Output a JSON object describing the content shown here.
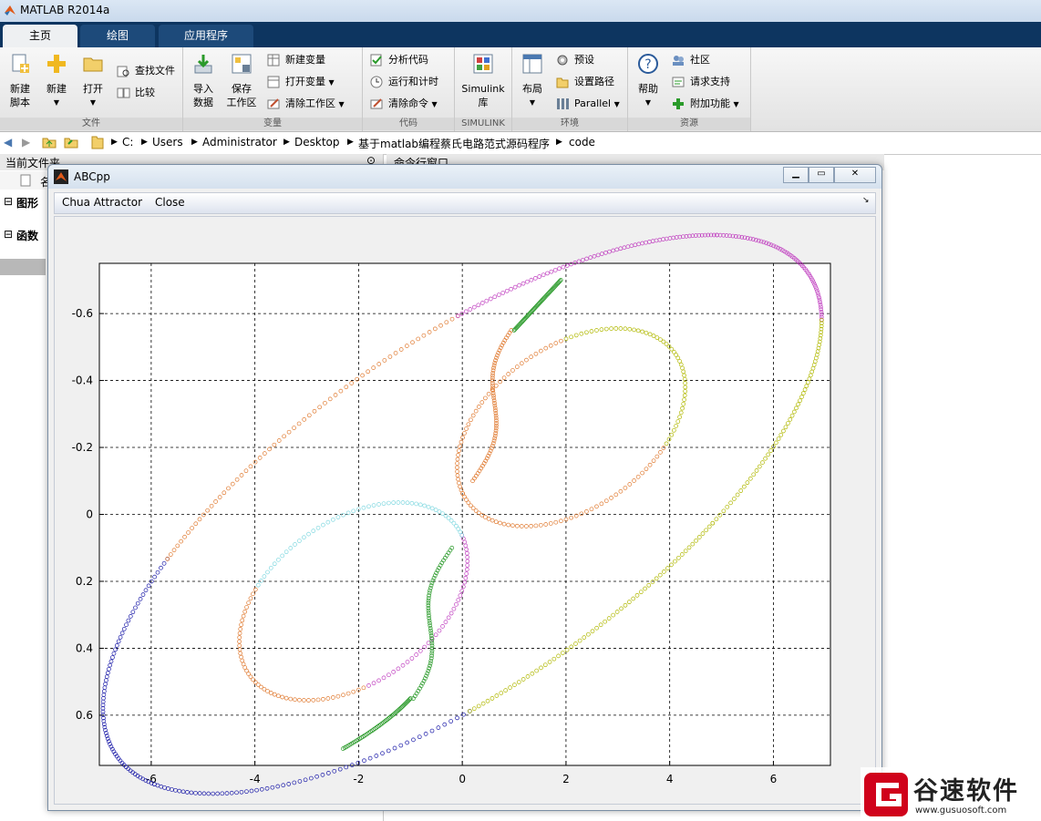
{
  "app": {
    "title": "MATLAB R2014a"
  },
  "tabs": [
    "主页",
    "绘图",
    "应用程序"
  ],
  "ribbon": {
    "file": {
      "label": "文件",
      "new_script": "新建\n脚本",
      "new": "新建",
      "open": "打开",
      "find_files": "查找文件",
      "compare": "比较"
    },
    "variable": {
      "label": "变量",
      "import": "导入\n数据",
      "save": "保存\n工作区",
      "new_var": "新建变量",
      "open_var": "打开变量",
      "clear_ws": "清除工作区"
    },
    "code": {
      "label": "代码",
      "analyze": "分析代码",
      "run_time": "运行和计时",
      "clear_cmd": "清除命令"
    },
    "simulink": {
      "label": "SIMULINK",
      "lib": "Simulink\n库"
    },
    "env": {
      "label": "环境",
      "layout": "布局",
      "prefs": "预设",
      "set_path": "设置路径",
      "parallel": "Parallel"
    },
    "resources": {
      "label": "资源",
      "help": "帮助",
      "community": "社区",
      "support": "请求支持",
      "addons": "附加功能"
    }
  },
  "address": [
    "C:",
    "Users",
    "Administrator",
    "Desktop",
    "基于matlab编程蔡氏电路范式源码程序",
    "code"
  ],
  "left_panel": {
    "title": "当前文件夹",
    "col": "名",
    "sec1": "图形",
    "sec2": "函数"
  },
  "cmd_panel": {
    "title": "命令行窗口"
  },
  "figure": {
    "title": "ABCpp",
    "menu": [
      "Chua Attractor",
      "Close"
    ],
    "colors": {
      "blue": "#0000cc",
      "magenta": "#cc00cc",
      "green": "#2a9a2a",
      "olive": "#b8c000",
      "orange": "#e07a30",
      "cyan": "#7fd8e0",
      "red": "#cc2222"
    }
  },
  "chart_data": {
    "type": "scatter",
    "xticks": [
      "-6",
      "-4",
      "-2",
      "0",
      "2",
      "4",
      "6"
    ],
    "yticks": [
      "-0.6",
      "-0.4",
      "-0.2",
      "0",
      "0.2",
      "0.4",
      "0.6"
    ],
    "xlim": [
      -7,
      7.1
    ],
    "ylim": [
      -0.75,
      0.75
    ],
    "y_reversed": true,
    "grid": true,
    "series": [
      {
        "color": "#1a1aa8",
        "segment": "outer-left-loop"
      },
      {
        "color": "#c040c0",
        "segment": "outer-lower-right"
      },
      {
        "color": "#b0b800",
        "segment": "outer-upper-right"
      },
      {
        "color": "#e07a30",
        "segment": "inner-loops"
      },
      {
        "color": "#80d8e0",
        "segment": "inner-left"
      },
      {
        "color": "#2a9a2a",
        "segment": "spines"
      }
    ]
  },
  "watermark": {
    "name": "谷速软件",
    "url": "www.gusuosoft.com"
  }
}
